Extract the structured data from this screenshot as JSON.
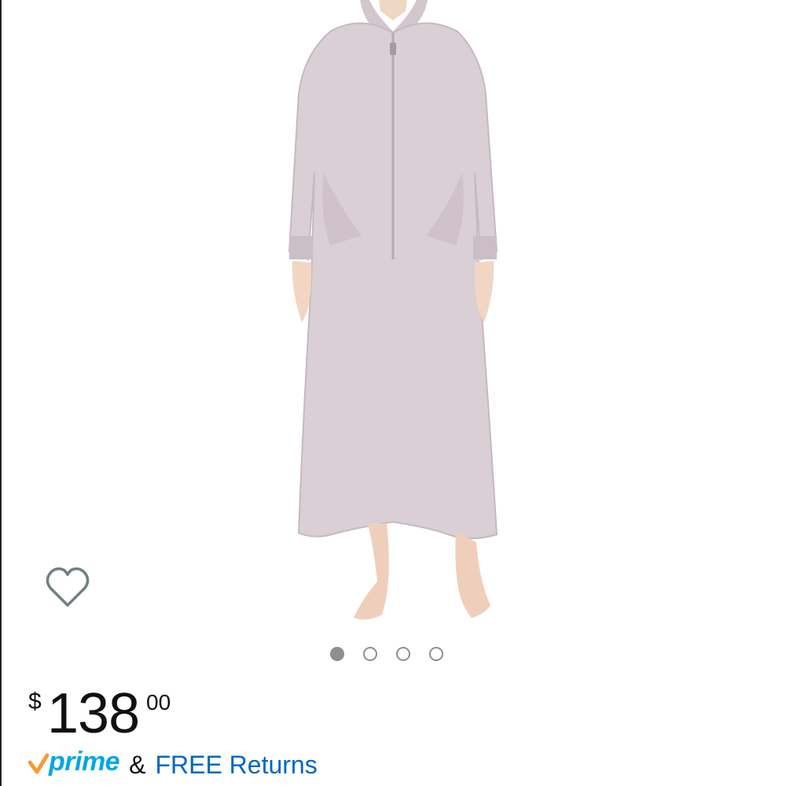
{
  "product": {
    "image_icon": "robe-product-photo"
  },
  "wishlist": {
    "icon": "heart-outline-icon"
  },
  "carousel": {
    "total": 4,
    "active_index": 0
  },
  "price": {
    "currency_symbol": "$",
    "whole": "138",
    "fraction": "00"
  },
  "shipping": {
    "prime_label": "prime",
    "ampersand": "&",
    "returns_label": "FREE Returns"
  },
  "colors": {
    "prime_blue": "#00a8e1",
    "prime_check": "#f79c34",
    "link_blue": "#0066c0",
    "dot_gray": "#8f8f8f",
    "robe": "#d8cdd3"
  }
}
